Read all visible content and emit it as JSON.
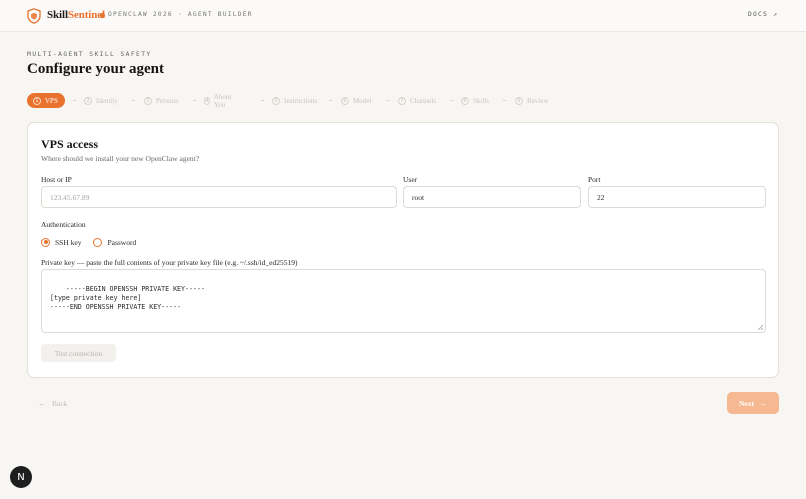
{
  "header": {
    "brand_prefix": "Skill",
    "brand_suffix": "Sentinel",
    "subtitle": "OPENCLAW 2026 · AGENT BUILDER",
    "docs_label": "DOCS ↗"
  },
  "page": {
    "eyebrow": "MULTI-AGENT SKILL SAFETY",
    "title": "Configure your agent"
  },
  "steps": [
    {
      "num": "1",
      "label": "VPS"
    },
    {
      "num": "2",
      "label": "Identity"
    },
    {
      "num": "3",
      "label": "Persona"
    },
    {
      "num": "4",
      "label": "About You"
    },
    {
      "num": "5",
      "label": "Instructions"
    },
    {
      "num": "6",
      "label": "Model"
    },
    {
      "num": "7",
      "label": "Channels"
    },
    {
      "num": "8",
      "label": "Skills"
    },
    {
      "num": "9",
      "label": "Review"
    }
  ],
  "card": {
    "title": "VPS access",
    "subtitle": "Where should we install your new OpenClaw agent?",
    "host_label": "Host or IP",
    "host_placeholder": "123.45.67.89",
    "user_label": "User",
    "user_value": "root",
    "port_label": "Port",
    "port_value": "22",
    "auth_label": "Authentication",
    "auth_options": [
      "SSH key",
      "Password"
    ],
    "key_label": "Private key — paste the full contents of your private key file (e.g. ~/.ssh/id_ed25519)",
    "key_value": "-----BEGIN OPENSSH PRIVATE KEY-----\n[type private key here]\n-----END OPENSSH PRIVATE KEY-----",
    "test_label": "Test connection"
  },
  "footer": {
    "back_label": "Back",
    "next_label": "Next"
  },
  "badge": "N",
  "colors": {
    "accent": "#e8722e",
    "accent_disabled": "#f5b891"
  }
}
